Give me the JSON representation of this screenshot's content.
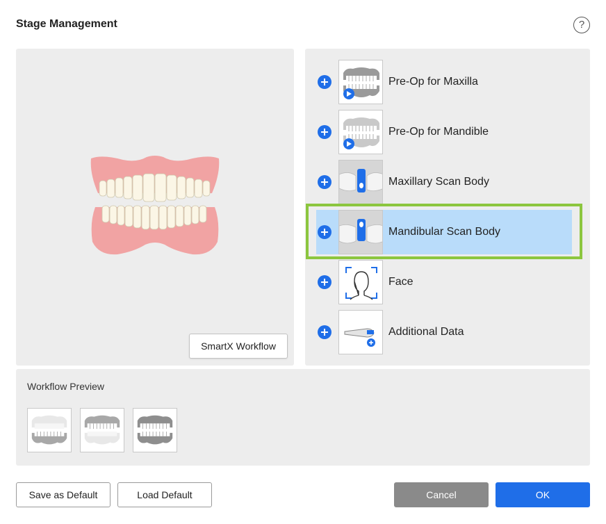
{
  "dialog": {
    "title": "Stage Management",
    "help_label": "?"
  },
  "preview": {
    "smartx_label": "SmartX Workflow"
  },
  "stages": [
    {
      "label": "Pre-Op for Maxilla",
      "icon": "pre-op-maxilla-icon",
      "selected": false
    },
    {
      "label": "Pre-Op for Mandible",
      "icon": "pre-op-mandible-icon",
      "selected": false
    },
    {
      "label": "Maxillary Scan Body",
      "icon": "maxillary-scan-body-icon",
      "selected": false
    },
    {
      "label": "Mandibular Scan Body",
      "icon": "mandibular-scan-body-icon",
      "selected": true
    },
    {
      "label": "Face",
      "icon": "face-icon",
      "selected": false
    },
    {
      "label": "Additional Data",
      "icon": "additional-data-icon",
      "selected": false
    }
  ],
  "workflow_preview": {
    "label": "Workflow Preview",
    "steps": [
      "upper-jaw-scan",
      "lower-jaw-scan",
      "occlusion-scan"
    ]
  },
  "buttons": {
    "save_default": "Save as Default",
    "load_default": "Load Default",
    "cancel": "Cancel",
    "ok": "OK"
  },
  "colors": {
    "accent": "#1f6ee8",
    "selection": "#b9dcfa",
    "highlight": "#8cc63f",
    "panel": "#ededed",
    "gum": "#f1a3a3",
    "cancel": "#8a8a8a"
  }
}
